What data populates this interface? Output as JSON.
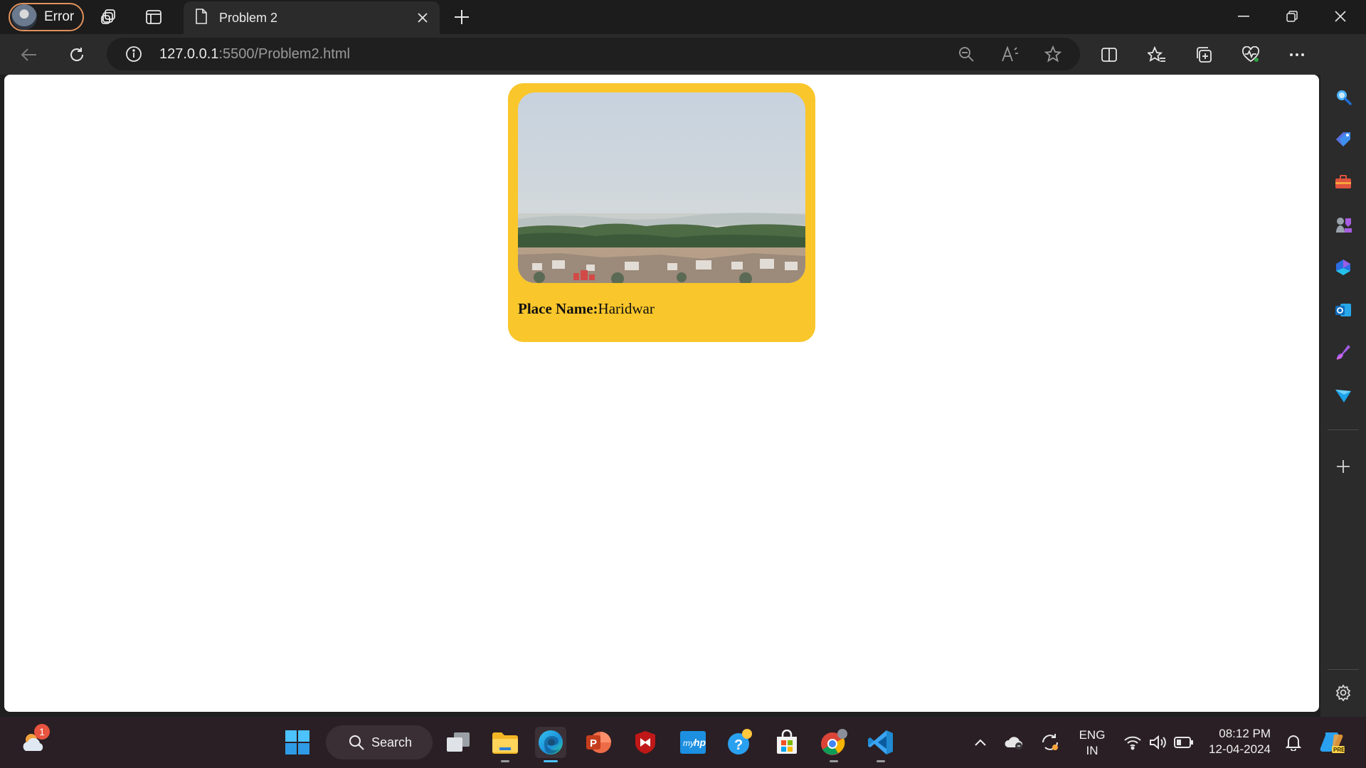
{
  "profile": {
    "label": "Error"
  },
  "tab": {
    "title": "Problem 2"
  },
  "address": {
    "host": "127.0.0.1",
    "path": ":5500/Problem2.html"
  },
  "page": {
    "place_label": "Place Name:",
    "place_value": "Haridwar",
    "card_color": "#f9c62b"
  },
  "taskbar": {
    "search_label": "Search",
    "weather_badge": "1",
    "lang_line1": "ENG",
    "lang_line2": "IN",
    "time": "08:12 PM",
    "date": "12-04-2024"
  },
  "icons": {
    "titlebar": [
      "workspaces-icon",
      "vertical-tabs-icon",
      "page-icon",
      "close-icon",
      "new-tab-icon",
      "minimize-icon",
      "restore-icon",
      "close-window-icon"
    ],
    "navbar": [
      "back-icon",
      "refresh-icon",
      "info-icon",
      "zoom-out-icon",
      "read-aloud-icon",
      "favorite-star-icon",
      "split-screen-icon",
      "favorites-icon",
      "collections-icon",
      "browser-essentials-icon",
      "more-icon",
      "copilot-icon"
    ],
    "sidebar": [
      "search-icon",
      "shopping-icon",
      "tools-icon",
      "games-icon",
      "bing-icon",
      "outlook-icon",
      "designer-icon",
      "drop-icon",
      "add-icon",
      "settings-icon"
    ],
    "taskbar": [
      "weather-icon",
      "start-icon",
      "task-view-icon",
      "file-explorer-icon",
      "edge-icon",
      "powerpoint-icon",
      "mcafee-icon",
      "myhp-icon",
      "get-help-icon",
      "store-icon",
      "chrome-icon",
      "vscode-icon"
    ]
  }
}
